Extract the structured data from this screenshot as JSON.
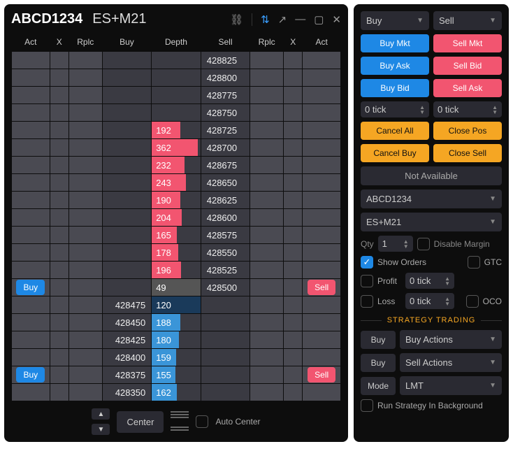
{
  "header": {
    "account": "ABCD1234",
    "symbol": "ES+M21"
  },
  "columns": {
    "act": "Act",
    "x": "X",
    "rplc": "Rplc",
    "buy": "Buy",
    "depth": "Depth",
    "sell": "Sell"
  },
  "rows": [
    {
      "sell_price": "428825",
      "depth": "",
      "depth_type": "",
      "depth_pct": 0
    },
    {
      "sell_price": "428800",
      "depth": "",
      "depth_type": "",
      "depth_pct": 0
    },
    {
      "sell_price": "428775",
      "depth": "",
      "depth_type": "",
      "depth_pct": 0
    },
    {
      "sell_price": "428750",
      "depth": "",
      "depth_type": "",
      "depth_pct": 0
    },
    {
      "sell_price": "428725",
      "depth": "192",
      "depth_type": "ask",
      "depth_pct": 58
    },
    {
      "sell_price": "428700",
      "depth": "362",
      "depth_type": "ask",
      "depth_pct": 95
    },
    {
      "sell_price": "428675",
      "depth": "232",
      "depth_type": "ask",
      "depth_pct": 68
    },
    {
      "sell_price": "428650",
      "depth": "243",
      "depth_type": "ask",
      "depth_pct": 70
    },
    {
      "sell_price": "428625",
      "depth": "190",
      "depth_type": "ask",
      "depth_pct": 58
    },
    {
      "sell_price": "428600",
      "depth": "204",
      "depth_type": "ask",
      "depth_pct": 62
    },
    {
      "sell_price": "428575",
      "depth": "165",
      "depth_type": "ask",
      "depth_pct": 52
    },
    {
      "sell_price": "428550",
      "depth": "178",
      "depth_type": "ask",
      "depth_pct": 55
    },
    {
      "sell_price": "428525",
      "depth": "196",
      "depth_type": "ask",
      "depth_pct": 60
    },
    {
      "sell_price": "428500",
      "depth": "49",
      "depth_type": "mid",
      "depth_pct": 100,
      "act_buy": "Buy",
      "act_sell": "Sell"
    },
    {
      "buy_price": "428475",
      "depth": "120",
      "depth_type": "cur",
      "depth_pct": 100
    },
    {
      "buy_price": "428450",
      "depth": "188",
      "depth_type": "bid",
      "depth_pct": 58
    },
    {
      "buy_price": "428425",
      "depth": "180",
      "depth_type": "bid",
      "depth_pct": 56
    },
    {
      "buy_price": "428400",
      "depth": "159",
      "depth_type": "bid",
      "depth_pct": 50
    },
    {
      "buy_price": "428375",
      "depth": "155",
      "depth_type": "bid",
      "depth_pct": 48,
      "act_buy": "Buy",
      "act_sell": "Sell"
    },
    {
      "buy_price": "428350",
      "depth": "162",
      "depth_type": "bid",
      "depth_pct": 52
    }
  ],
  "footer": {
    "center": "Center",
    "auto_center": "Auto Center"
  },
  "side": {
    "buy": "Buy",
    "sell": "Sell",
    "buy_mkt": "Buy Mkt",
    "sell_mkt": "Sell Mkt",
    "buy_ask": "Buy Ask",
    "sell_bid": "Sell Bid",
    "buy_bid": "Buy Bid",
    "sell_ask": "Sell Ask",
    "tick0a": "0 tick",
    "tick0b": "0 tick",
    "cancel_all": "Cancel All",
    "close_pos": "Close Pos",
    "cancel_buy": "Cancel Buy",
    "close_sell": "Close Sell",
    "na": "Not Available",
    "account": "ABCD1234",
    "symbol": "ES+M21",
    "qty_label": "Qty",
    "qty_val": "1",
    "disable_margin": "Disable Margin",
    "show_orders": "Show Orders",
    "gtc": "GTC",
    "profit": "Profit",
    "profit_val": "0 tick",
    "loss": "Loss",
    "loss_val": "0 tick",
    "oco": "OCO",
    "strategy_head": "STRATEGY TRADING",
    "buy_actions": "Buy Actions",
    "sell_actions": "Sell Actions",
    "mode": "Mode",
    "mode_val": "LMT",
    "run_bg": "Run Strategy In Background"
  }
}
